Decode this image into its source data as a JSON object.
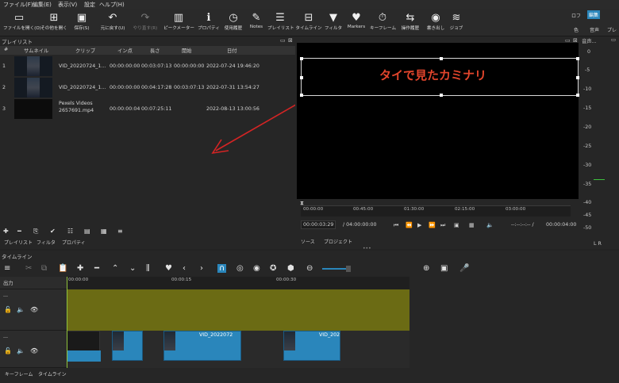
{
  "menu": [
    "ファイル(F)",
    "編集(E)",
    "表示(V)",
    "設定",
    "ヘルプ(H)"
  ],
  "toolbar": {
    "open": "ファイルを開く(O)",
    "other": "その他を開く",
    "save": "保存(S)",
    "undo": "元に戻す(U)",
    "redo": "やり直す(R)",
    "peak": "ピークメーター",
    "properties": "プロパティ",
    "history": "使用履歴",
    "notes": "Notes",
    "playlist": "プレイリスト",
    "timeline": "タイムライン",
    "filter": "フィルタ",
    "markers": "Markers",
    "keyframe": "キーフレーム",
    "ophistory": "操作履歴",
    "export": "書き出し",
    "jobs": "ジョブ",
    "layout_logging": "ロフ",
    "layout_editing": "編集",
    "layout_color": "色",
    "layout_audio": "音声",
    "layout_player": "プレ"
  },
  "playlist": {
    "title": "プレイリスト",
    "columns": [
      "#",
      "サムネイル",
      "クリップ",
      "イン点",
      "長さ",
      "開始",
      "日付"
    ],
    "rows": [
      {
        "num": "1",
        "clip": "VID_20220724_1...",
        "in": "00:00:00:00",
        "length": "00:03:07:13",
        "start": "00:00:00:00",
        "date": "2022-07-24 19:46:20"
      },
      {
        "num": "2",
        "clip": "VID_20220724_1...",
        "in": "00:00:00:00",
        "length": "00:04:17:28",
        "start": "00:03:07:13",
        "date": "2022-07-31 13:54:27"
      },
      {
        "num": "3",
        "clip": "Pexels Videos",
        "clip2": "2657691.mp4",
        "in": "00:00:00:04",
        "length": "00:07:25:11",
        "start": "",
        "date": "2022-08-13 13:00:56"
      }
    ],
    "subtabs": [
      "プレイリスト",
      "フィルタ",
      "プロパティ"
    ]
  },
  "player": {
    "overlay_text": "タイで見たカミナリ",
    "ruler": [
      "00:00:00",
      "00:45:00",
      "01:30:00",
      "02:15:00",
      "03:00:00"
    ],
    "current_time": "00:00:03:29",
    "total_time": "/ 04:00:00:00",
    "in_out": "--:--:--:-- /",
    "end_time": "00:00:04:00",
    "tabs": [
      "ソース",
      "プロジェクト"
    ]
  },
  "meter": {
    "title": "音声...",
    "scale": [
      "0",
      "-5",
      "-10",
      "-15",
      "-20",
      "-25",
      "-30",
      "-35",
      "-40",
      "-45",
      "-50"
    ],
    "lr": "L  R"
  },
  "timeline": {
    "title": "タイムライン",
    "output": "出力",
    "ruler": [
      "00:00:00",
      "00:00:15",
      "00:00:30"
    ],
    "clips": [
      {
        "label": ""
      },
      {
        "label": ""
      },
      {
        "label": "VID_2022072"
      },
      {
        "label": "VID_202"
      }
    ],
    "bottom_tabs": [
      "キーフレーム",
      "タイムライン"
    ]
  },
  "colors": {
    "accent": "#2a86bb",
    "overlay": "#e2452c",
    "track": "#6b6b14",
    "arrow": "#d42424"
  }
}
